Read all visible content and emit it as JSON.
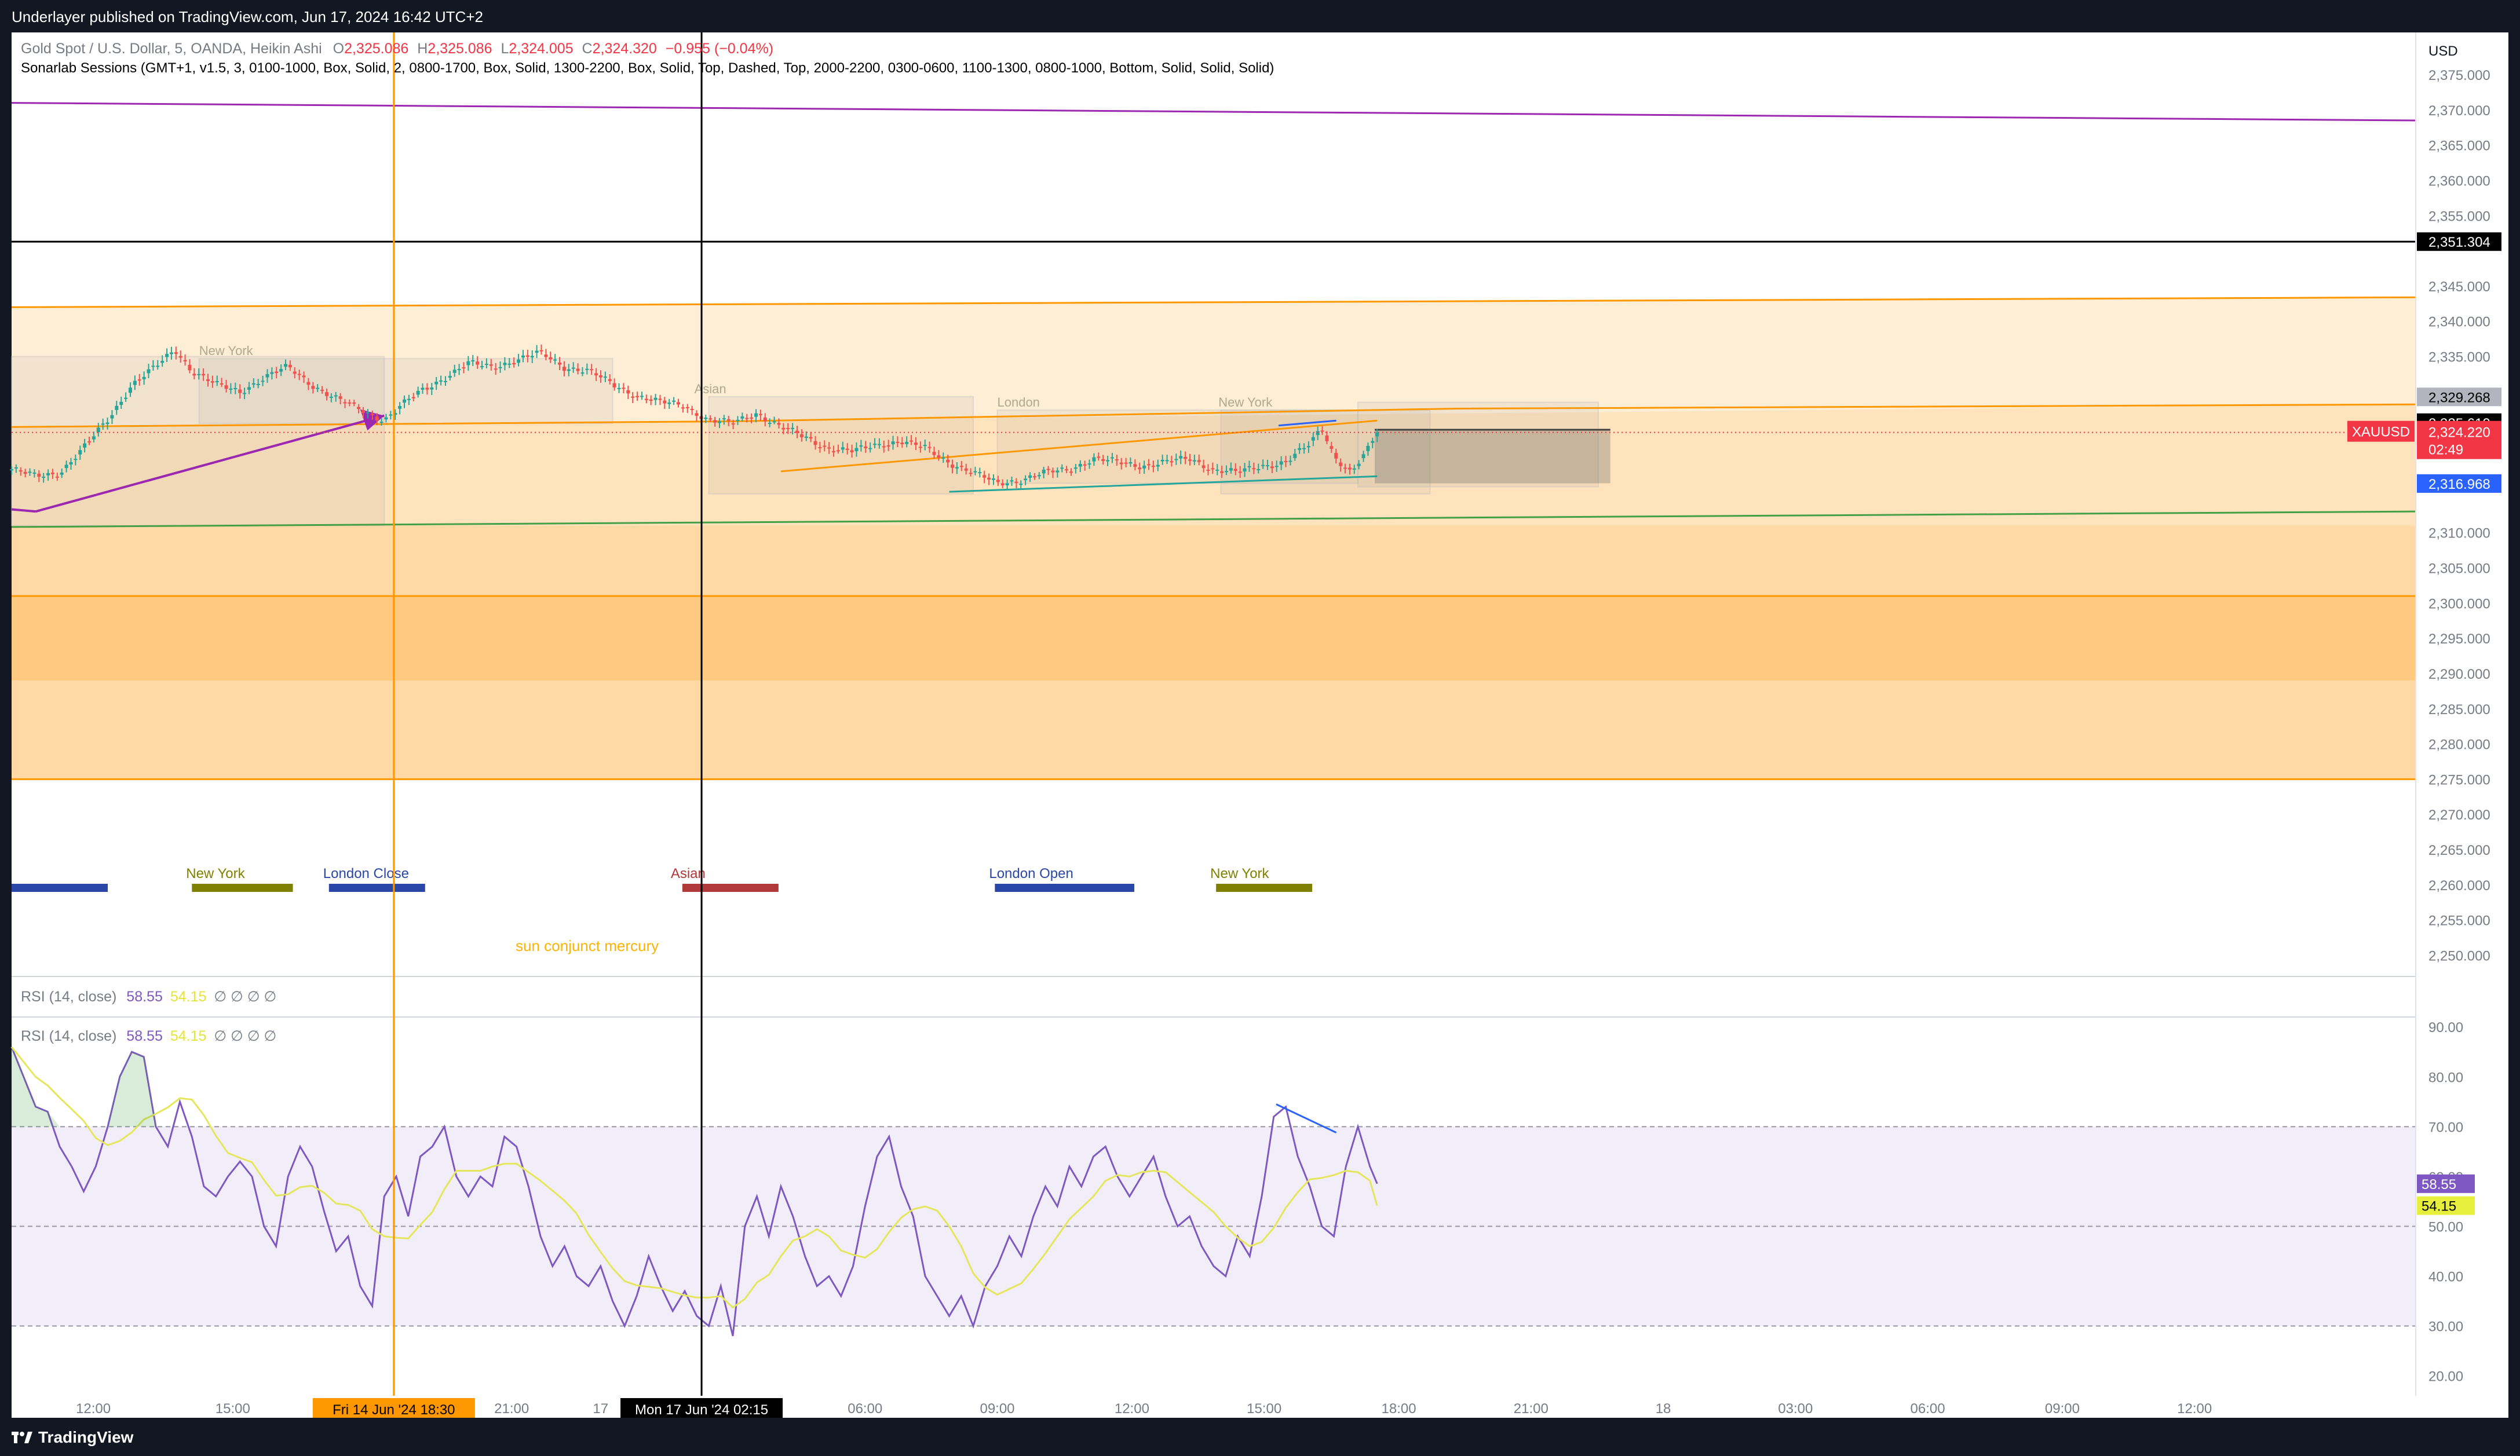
{
  "header": {
    "published": "Underlayer published on TradingView.com, Jun 17, 2024 16:42 UTC+2"
  },
  "footer": {
    "brand": "TradingView",
    "logo_icon": "tradingview-logo-icon"
  },
  "main_legend": {
    "symbol": "Gold Spot / U.S. Dollar, 5, OANDA, Heikin Ashi",
    "o_label": "O",
    "o_value": "2,325.086",
    "h_label": "H",
    "h_value": "2,325.086",
    "l_label": "L",
    "l_value": "2,324.005",
    "c_label": "C",
    "c_value": "2,324.320",
    "change": "−0.955 (−0.04%)",
    "sessions": "Sonarlab Sessions (GMT+1, v1.5, 3, 0100-1000, Box, Solid, 2, 0800-1700, Box, Solid, 1300-2200, Box, Solid, Top, Dashed, Top, 2000-2200, 0300-0600, 1100-1300, 0800-1000, Bottom, Solid, Solid, Solid)"
  },
  "rsi_legend": {
    "title": "RSI (14, close)",
    "rsi": "58.55",
    "ma": "54.15",
    "extras": "∅ ∅ ∅ ∅"
  },
  "rsi_legend2": {
    "title": "RSI (14, close)",
    "rsi": "58.55",
    "ma": "54.15",
    "extras": "∅ ∅ ∅ ∅"
  },
  "currency": "USD",
  "colors": {
    "orange": "#ff9800",
    "purple": "#9c27b0",
    "green": "#43a047",
    "black": "#000000",
    "candle_up": "#26a69a",
    "candle_down": "#ef5350",
    "rsi": "#7e57c2",
    "rsi_ma": "#e6e65c"
  },
  "price_axis": {
    "ticks": [
      "2,375.000",
      "2,370.000",
      "2,365.000",
      "2,360.000",
      "2,355.000",
      "2,345.000",
      "2,340.000",
      "2,335.000",
      "2,310.000",
      "2,305.000",
      "2,300.000",
      "2,295.000",
      "2,290.000",
      "2,285.000",
      "2,280.000",
      "2,275.000",
      "2,270.000",
      "2,265.000",
      "2,260.000",
      "2,255.000",
      "2,250.000"
    ],
    "tick_values": [
      2375,
      2370,
      2365,
      2360,
      2355,
      2345,
      2340,
      2335,
      2310,
      2305,
      2300,
      2295,
      2290,
      2285,
      2280,
      2275,
      2270,
      2265,
      2260,
      2255,
      2250
    ],
    "range": [
      2247,
      2381
    ],
    "badges": [
      {
        "value": 2351.304,
        "label": "2,351.304",
        "bg": "#000000",
        "fg": "#ffffff"
      },
      {
        "value": 2329.268,
        "label": "2,329.268",
        "bg": "#b2b5be",
        "fg": "#000000"
      },
      {
        "value": 2325.61,
        "label": "2,325.610",
        "bg": "#000000",
        "fg": "#ffffff"
      },
      {
        "value": 2316.968,
        "label": "2,316.968",
        "bg": "#2962ff",
        "fg": "#ffffff"
      }
    ],
    "current": {
      "symbol": "XAUUSD",
      "price": "2,324.220",
      "countdown": "02:49",
      "value": 2324.22
    }
  },
  "rsi_axis": {
    "ticks": [
      "90.00",
      "80.00",
      "70.00",
      "60.00",
      "50.00",
      "40.00",
      "30.00",
      "20.00"
    ],
    "tick_values": [
      90,
      80,
      70,
      60,
      50,
      40,
      30,
      20
    ],
    "range": [
      16,
      92
    ],
    "bands": [
      30,
      50,
      70
    ],
    "rsi_badge": {
      "label": "58.55",
      "value": 58.55
    },
    "ma_badge": {
      "label": "54.15",
      "value": 54.15
    }
  },
  "time_axis": {
    "labels": [
      {
        "t": "12:00",
        "x": 0.034
      },
      {
        "t": "15:00",
        "x": 0.092
      },
      {
        "t": "21:00",
        "x": 0.208
      },
      {
        "t": "17",
        "x": 0.245
      },
      {
        "t": "06:00",
        "x": 0.355
      },
      {
        "t": "09:00",
        "x": 0.41
      },
      {
        "t": "12:00",
        "x": 0.466
      },
      {
        "t": "15:00",
        "x": 0.521
      },
      {
        "t": "18:00",
        "x": 0.577
      },
      {
        "t": "21:00",
        "x": 0.632
      },
      {
        "t": "18",
        "x": 0.687
      },
      {
        "t": "03:00",
        "x": 0.742
      },
      {
        "t": "06:00",
        "x": 0.797
      },
      {
        "t": "09:00",
        "x": 0.853
      },
      {
        "t": "12:00",
        "x": 0.908
      }
    ],
    "markers": [
      {
        "label": "Fri 14 Jun '24   18:30",
        "x": 0.159,
        "bg": "#ff9800",
        "fg": "#000000"
      },
      {
        "label": "Mon 17 Jun '24   02:15",
        "x": 0.287,
        "bg": "#000000",
        "fg": "#ffffff"
      }
    ]
  },
  "session_labels": [
    {
      "label": "New York",
      "color": "#808000",
      "x0": 0.075,
      "x1": 0.117
    },
    {
      "label": "London Close",
      "color": "#2a47a8",
      "x0": 0.132,
      "x1": 0.172
    },
    {
      "label": "Asian",
      "color": "#b03a3a",
      "x0": 0.279,
      "x1": 0.319
    },
    {
      "label": "London Open",
      "color": "#2a47a8",
      "x0": 0.409,
      "x1": 0.467
    },
    {
      "label": "New York",
      "color": "#808000",
      "x0": 0.501,
      "x1": 0.541
    }
  ],
  "session_box_labels": [
    {
      "label": "New York",
      "x": 0.078,
      "y": 2334.7
    },
    {
      "label": "Asian",
      "x": 0.284,
      "y": 2329.3
    },
    {
      "label": "London",
      "x": 0.41,
      "y": 2327.4
    },
    {
      "label": "New York",
      "x": 0.502,
      "y": 2327.4
    }
  ],
  "annotation": {
    "text": "sun conjunct mercury"
  },
  "chart_data": {
    "type": "candlestick",
    "style": "Heikin Ashi",
    "symbol": "XAUUSD",
    "interval": "5",
    "price_levels": {
      "horizontal_black": 2351.304,
      "purple_line": [
        2371,
        2368.5
      ],
      "orange_upper_trend": [
        2342,
        2343.4
      ],
      "orange_mid_trend": [
        2325,
        2328.2
      ],
      "green_lower_trend": [
        2310.8,
        2313
      ]
    },
    "close_path": [
      [
        0.0,
        2319.0
      ],
      [
        0.01,
        2318.0
      ],
      [
        0.02,
        2318.5
      ],
      [
        0.03,
        2322.0
      ],
      [
        0.04,
        2326.0
      ],
      [
        0.05,
        2331.0
      ],
      [
        0.06,
        2333.5
      ],
      [
        0.068,
        2336.0
      ],
      [
        0.075,
        2333.0
      ],
      [
        0.085,
        2331.0
      ],
      [
        0.095,
        2330.0
      ],
      [
        0.105,
        2332.0
      ],
      [
        0.115,
        2333.5
      ],
      [
        0.125,
        2331.0
      ],
      [
        0.135,
        2329.0
      ],
      [
        0.145,
        2327.5
      ],
      [
        0.155,
        2326.0
      ],
      [
        0.162,
        2328.0
      ],
      [
        0.17,
        2330.0
      ],
      [
        0.18,
        2332.0
      ],
      [
        0.19,
        2334.0
      ],
      [
        0.2,
        2333.5
      ],
      [
        0.21,
        2334.5
      ],
      [
        0.22,
        2335.5
      ],
      [
        0.23,
        2333.5
      ],
      [
        0.24,
        2333.0
      ],
      [
        0.25,
        2331.0
      ],
      [
        0.26,
        2329.5
      ],
      [
        0.27,
        2328.5
      ],
      [
        0.28,
        2328.0
      ],
      [
        0.29,
        2326.0
      ],
      [
        0.3,
        2325.5
      ],
      [
        0.31,
        2327.0
      ],
      [
        0.32,
        2325.0
      ],
      [
        0.33,
        2323.5
      ],
      [
        0.34,
        2322.0
      ],
      [
        0.35,
        2321.5
      ],
      [
        0.36,
        2322.5
      ],
      [
        0.37,
        2323.0
      ],
      [
        0.38,
        2322.0
      ],
      [
        0.39,
        2320.0
      ],
      [
        0.4,
        2318.5
      ],
      [
        0.41,
        2317.0
      ],
      [
        0.42,
        2317.5
      ],
      [
        0.43,
        2318.5
      ],
      [
        0.44,
        2319.0
      ],
      [
        0.45,
        2320.5
      ],
      [
        0.46,
        2320.0
      ],
      [
        0.47,
        2319.5
      ],
      [
        0.48,
        2320.0
      ],
      [
        0.49,
        2320.5
      ],
      [
        0.5,
        2319.0
      ],
      [
        0.51,
        2318.5
      ],
      [
        0.52,
        2319.5
      ],
      [
        0.53,
        2320.0
      ],
      [
        0.54,
        2322.5
      ],
      [
        0.545,
        2325.0
      ],
      [
        0.55,
        2321.0
      ],
      [
        0.557,
        2318.5
      ],
      [
        0.563,
        2321.0
      ],
      [
        0.568,
        2324.3
      ]
    ],
    "rsi_path": [
      [
        0.0,
        86
      ],
      [
        0.005,
        80
      ],
      [
        0.01,
        74
      ],
      [
        0.015,
        73
      ],
      [
        0.02,
        66
      ],
      [
        0.025,
        62
      ],
      [
        0.03,
        57
      ],
      [
        0.035,
        62
      ],
      [
        0.04,
        70
      ],
      [
        0.045,
        80
      ],
      [
        0.05,
        85
      ],
      [
        0.055,
        84
      ],
      [
        0.06,
        70
      ],
      [
        0.065,
        66
      ],
      [
        0.07,
        75
      ],
      [
        0.075,
        68
      ],
      [
        0.08,
        58
      ],
      [
        0.085,
        56
      ],
      [
        0.09,
        60
      ],
      [
        0.095,
        63
      ],
      [
        0.1,
        60
      ],
      [
        0.105,
        50
      ],
      [
        0.11,
        46
      ],
      [
        0.115,
        60
      ],
      [
        0.12,
        66
      ],
      [
        0.125,
        62
      ],
      [
        0.13,
        53
      ],
      [
        0.135,
        45
      ],
      [
        0.14,
        48
      ],
      [
        0.145,
        38
      ],
      [
        0.15,
        34
      ],
      [
        0.155,
        56
      ],
      [
        0.16,
        60
      ],
      [
        0.165,
        52
      ],
      [
        0.17,
        64
      ],
      [
        0.175,
        66
      ],
      [
        0.18,
        70
      ],
      [
        0.185,
        60
      ],
      [
        0.19,
        56
      ],
      [
        0.195,
        60
      ],
      [
        0.2,
        58
      ],
      [
        0.205,
        68
      ],
      [
        0.21,
        66
      ],
      [
        0.215,
        58
      ],
      [
        0.22,
        48
      ],
      [
        0.225,
        42
      ],
      [
        0.23,
        46
      ],
      [
        0.235,
        40
      ],
      [
        0.24,
        38
      ],
      [
        0.245,
        42
      ],
      [
        0.25,
        35
      ],
      [
        0.255,
        30
      ],
      [
        0.26,
        36
      ],
      [
        0.265,
        44
      ],
      [
        0.27,
        38
      ],
      [
        0.275,
        33
      ],
      [
        0.28,
        37
      ],
      [
        0.285,
        32
      ],
      [
        0.29,
        30
      ],
      [
        0.295,
        38
      ],
      [
        0.3,
        28
      ],
      [
        0.305,
        50
      ],
      [
        0.31,
        56
      ],
      [
        0.315,
        48
      ],
      [
        0.32,
        58
      ],
      [
        0.325,
        52
      ],
      [
        0.33,
        44
      ],
      [
        0.335,
        38
      ],
      [
        0.34,
        40
      ],
      [
        0.345,
        36
      ],
      [
        0.35,
        42
      ],
      [
        0.355,
        54
      ],
      [
        0.36,
        64
      ],
      [
        0.365,
        68
      ],
      [
        0.37,
        58
      ],
      [
        0.375,
        52
      ],
      [
        0.38,
        40
      ],
      [
        0.385,
        36
      ],
      [
        0.39,
        32
      ],
      [
        0.395,
        36
      ],
      [
        0.4,
        30
      ],
      [
        0.405,
        38
      ],
      [
        0.41,
        42
      ],
      [
        0.415,
        48
      ],
      [
        0.42,
        44
      ],
      [
        0.425,
        52
      ],
      [
        0.43,
        58
      ],
      [
        0.435,
        54
      ],
      [
        0.44,
        62
      ],
      [
        0.445,
        58
      ],
      [
        0.45,
        64
      ],
      [
        0.455,
        66
      ],
      [
        0.46,
        60
      ],
      [
        0.465,
        56
      ],
      [
        0.47,
        60
      ],
      [
        0.475,
        64
      ],
      [
        0.48,
        56
      ],
      [
        0.485,
        50
      ],
      [
        0.49,
        52
      ],
      [
        0.495,
        46
      ],
      [
        0.5,
        42
      ],
      [
        0.505,
        40
      ],
      [
        0.51,
        48
      ],
      [
        0.515,
        44
      ],
      [
        0.52,
        56
      ],
      [
        0.525,
        72
      ],
      [
        0.53,
        74
      ],
      [
        0.535,
        64
      ],
      [
        0.54,
        58
      ],
      [
        0.545,
        50
      ],
      [
        0.55,
        48
      ],
      [
        0.555,
        62
      ],
      [
        0.56,
        70
      ],
      [
        0.565,
        62
      ],
      [
        0.568,
        58.55
      ]
    ],
    "rsi_ma_last": 54.15,
    "rsi_divergence": [
      [
        0.526,
        74.5
      ],
      [
        0.551,
        68.8
      ]
    ]
  }
}
